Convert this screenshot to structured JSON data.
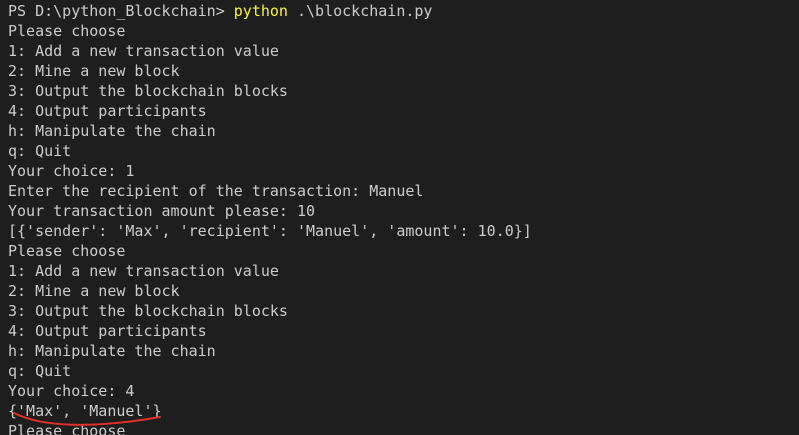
{
  "terminal": {
    "prompt_text": "PS D:\\python_Blockchain> ",
    "command": "python",
    "command_args": " .\\blockchain.py",
    "lines": [
      "Please choose",
      "1: Add a new transaction value",
      "2: Mine a new block",
      "3: Output the blockchain blocks",
      "4: Output participants",
      "h: Manipulate the chain",
      "q: Quit",
      "Your choice: 1",
      "Enter the recipient of the transaction: Manuel",
      "Your transaction amount please: 10",
      "[{'sender': 'Max', 'recipient': 'Manuel', 'amount': 10.0}]",
      "Please choose",
      "1: Add a new transaction value",
      "2: Mine a new block",
      "3: Output the blockchain blocks",
      "4: Output participants",
      "h: Manipulate the chain",
      "q: Quit",
      "Your choice: 4",
      "{'Max', 'Manuel'}",
      "Please choose"
    ],
    "colors": {
      "background": "#1e1e1e",
      "text": "#cccccc",
      "command": "#f5f543",
      "annotation": "#e0302a"
    }
  }
}
